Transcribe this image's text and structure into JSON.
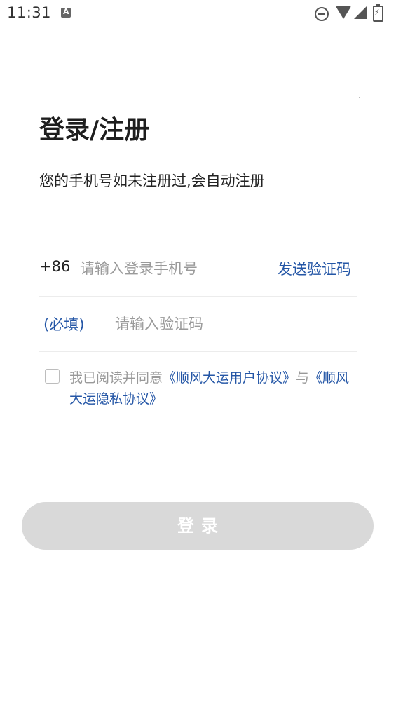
{
  "status_bar": {
    "time": "11:31"
  },
  "page": {
    "title": "登录/注册",
    "subtitle": "您的手机号如未注册过,会自动注册"
  },
  "phone_field": {
    "country_code": "+86",
    "placeholder": "请输入登录手机号",
    "value": "",
    "send_code_label": "发送验证码"
  },
  "code_field": {
    "required_label": "(必填)",
    "placeholder": "请输入验证码",
    "value": ""
  },
  "agreement": {
    "checked": false,
    "prefix": "我已阅读并同意",
    "user_agreement": "《顺风大运用户协议》",
    "connector": "与",
    "privacy_policy": "《顺风大运隐私协议》"
  },
  "login_button": {
    "label": "登录"
  },
  "icons": {
    "notification": "text-a-icon",
    "dnd": "do-not-disturb-icon",
    "wifi": "wifi-icon",
    "signal": "cell-signal-icon",
    "battery": "battery-charging-icon"
  },
  "colors": {
    "accent": "#2456a6",
    "button_disabled": "#d9d9d9",
    "placeholder": "#9a9a9a",
    "divider": "#ececec"
  }
}
